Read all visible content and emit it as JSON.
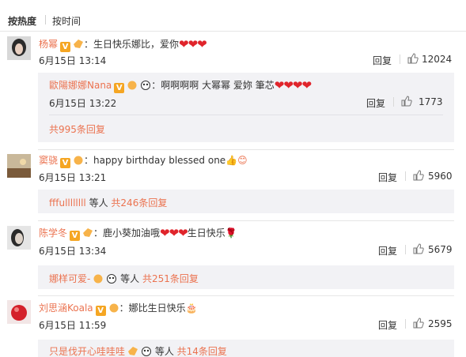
{
  "sort_bar": {
    "hot_label": "按热度",
    "time_label": "按时间"
  },
  "comments": [
    {
      "author": "杨幂",
      "text": "：生日快乐娜比，爱你",
      "time": "6月15日 13:14",
      "reply_label": "回复",
      "likes": "12024",
      "sub_reply": {
        "author": "歐陽娜娜Nana",
        "text": "：啊啊啊啊 大幂幂 爱妳 筆芯",
        "time": "6月15日 13:22",
        "reply_label": "回复",
        "likes": "1773"
      },
      "more_text": "共995条回复"
    },
    {
      "author": "窦骁",
      "text": "：happy birthday blessed one",
      "time": "6月15日 13:21",
      "reply_label": "回复",
      "likes": "5960",
      "more_prefix": "fffullllllll",
      "more_mid": " 等人 ",
      "more_text": "共246条回复"
    },
    {
      "author": "陈学冬",
      "text": "：鹿小葵加油哦",
      "text_suffix": "生日快乐",
      "time": "6月15日 13:34",
      "reply_label": "回复",
      "likes": "5679",
      "more_prefix": "娜样可爱-",
      "more_mid": " 等人 ",
      "more_text": "共251条回复"
    },
    {
      "author": "刘思涵Koala",
      "text": "：娜比生日快乐",
      "time": "6月15日 11:59",
      "reply_label": "回复",
      "likes": "2595",
      "more_prefix": "只是伐开心哇哇哇",
      "more_mid": " 等人 ",
      "more_text": "共14条回复"
    }
  ],
  "icons": {
    "verified": "V",
    "heart": "❤❤❤",
    "heart4": "❤❤❤❤",
    "thumb_emoji": "👍",
    "smile_emoji": "😊",
    "rose_emoji": "🌹",
    "cake_emoji": "🎂"
  },
  "colors": {
    "name": "#eb7350",
    "heart": "#e0242b",
    "subbox": "#f2f2f5",
    "badge": "#f5a623"
  }
}
